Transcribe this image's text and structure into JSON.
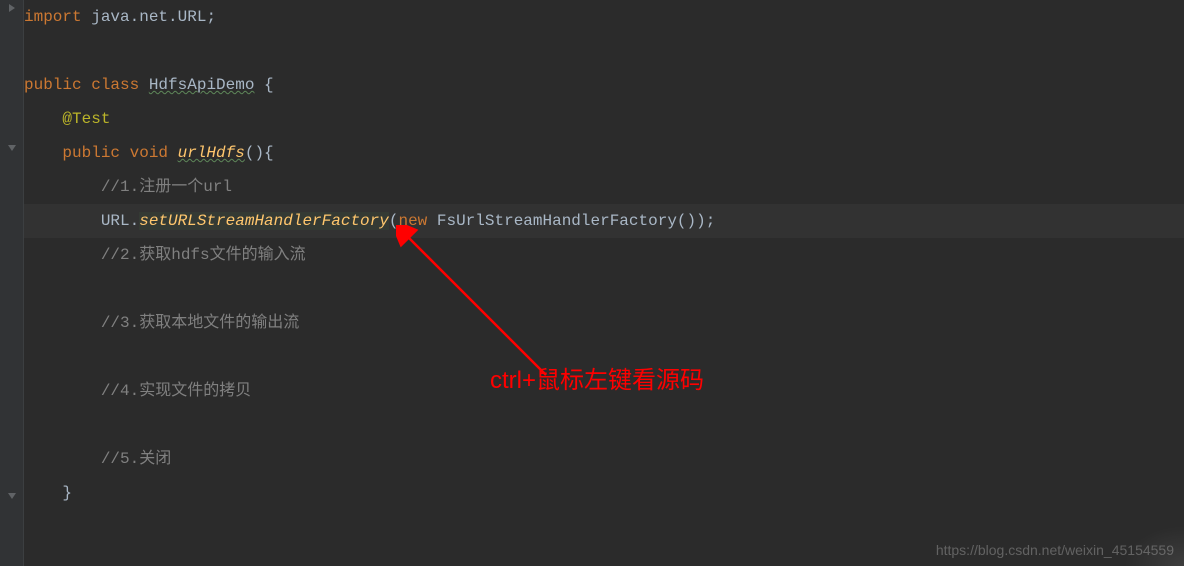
{
  "code": {
    "line1": {
      "import_kw": "import",
      "space1": " ",
      "pkg": "java.net.URL",
      "semi": ";"
    },
    "line3": {
      "public_kw": "public class ",
      "classname": "HdfsApiDemo",
      "brace": " {"
    },
    "line4": {
      "indent": "    ",
      "annotation": "@Test"
    },
    "line5": {
      "indent": "    ",
      "pub_void": "public void ",
      "method": "urlHdfs",
      "parens": "(){"
    },
    "line6": {
      "indent": "        ",
      "comment": "//1.注册一个url"
    },
    "line7": {
      "indent": "        ",
      "url_class": "URL.",
      "static_method": "setURLStreamHandlerFactory",
      "open": "(",
      "new_kw": "new ",
      "handler": "FsUrlStreamHandlerFactory",
      "close": "());"
    },
    "line8": {
      "indent": "        ",
      "comment": "//2.获取hdfs文件的输入流"
    },
    "line10": {
      "indent": "        ",
      "comment": "//3.获取本地文件的输出流"
    },
    "line12": {
      "indent": "        ",
      "comment": "//4.实现文件的拷贝"
    },
    "line14": {
      "indent": "        ",
      "comment": "//5.关闭"
    },
    "line15": {
      "indent": "    ",
      "brace": "}"
    }
  },
  "annotation_text": "ctrl+鼠标左键看源码",
  "watermark": "https://blog.csdn.net/weixin_45154559"
}
